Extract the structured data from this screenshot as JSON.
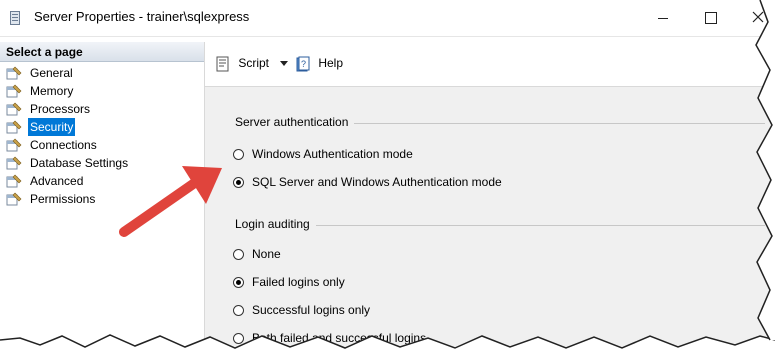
{
  "window": {
    "title": "Server Properties - trainer\\sqlexpress",
    "minimize_glyph": "—",
    "maximize_glyph": "☐",
    "close_glyph": "✕"
  },
  "sidebar": {
    "header": "Select a page",
    "items": [
      {
        "label": "General",
        "icon": "page-wrench-icon",
        "selected": false
      },
      {
        "label": "Memory",
        "icon": "page-wrench-icon",
        "selected": false
      },
      {
        "label": "Processors",
        "icon": "page-wrench-icon",
        "selected": false
      },
      {
        "label": "Security",
        "icon": "page-wrench-icon",
        "selected": true
      },
      {
        "label": "Connections",
        "icon": "page-wrench-icon",
        "selected": false
      },
      {
        "label": "Database Settings",
        "icon": "page-wrench-icon",
        "selected": false
      },
      {
        "label": "Advanced",
        "icon": "page-wrench-icon",
        "selected": false
      },
      {
        "label": "Permissions",
        "icon": "page-wrench-icon",
        "selected": false
      }
    ]
  },
  "toolbar": {
    "script_label": "Script",
    "script_icon": "script-icon",
    "dropdown_icon": "caret-down-icon",
    "help_label": "Help",
    "help_icon": "help-book-icon"
  },
  "server_auth": {
    "title": "Server authentication",
    "options": [
      {
        "label": "Windows Authentication mode",
        "checked": false
      },
      {
        "label": "SQL Server and Windows Authentication mode",
        "checked": true
      }
    ]
  },
  "login_auditing": {
    "title": "Login auditing",
    "options": [
      {
        "label": "None",
        "checked": false
      },
      {
        "label": "Failed logins only",
        "checked": true
      },
      {
        "label": "Successful logins only",
        "checked": false
      },
      {
        "label": "Both failed and successful logins",
        "checked": false
      }
    ]
  },
  "annotation": {
    "arrow_color": "#e0443c",
    "selection_color": "#0078d7"
  }
}
